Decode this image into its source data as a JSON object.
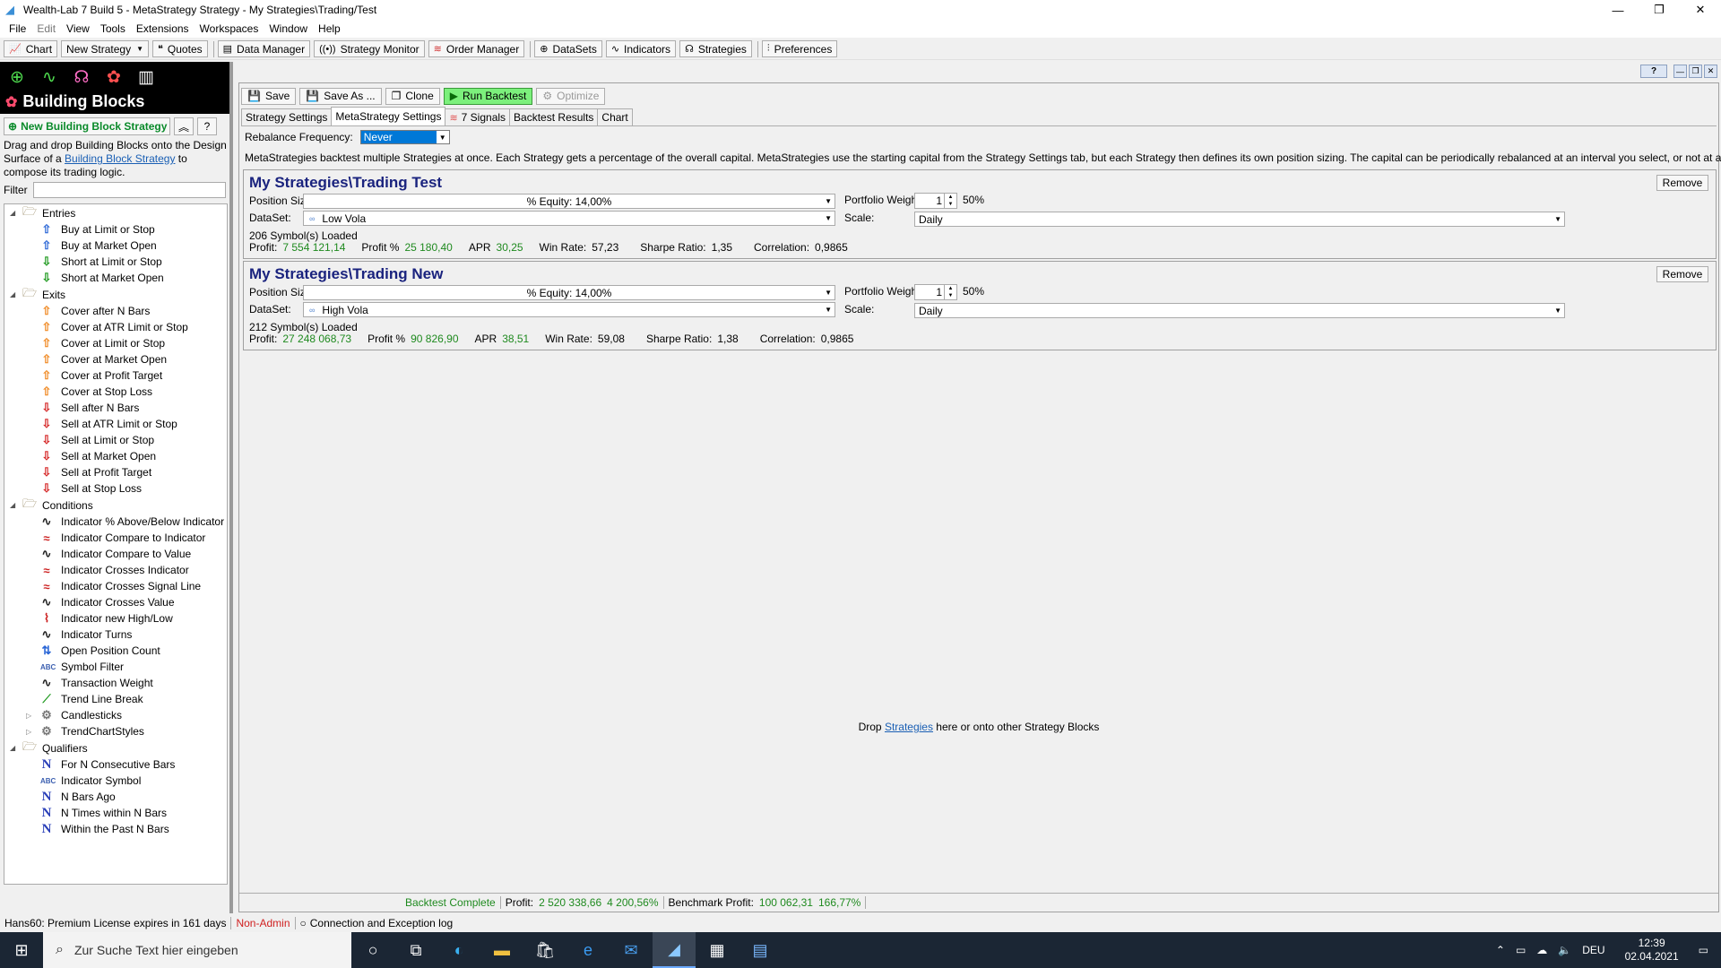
{
  "window": {
    "title": "Wealth-Lab 7 Build 5 - MetaStrategy Strategy - My Strategies\\Trading/Test",
    "minimize": "—",
    "restore": "❐",
    "close": "✕"
  },
  "menu": [
    "File",
    "Edit",
    "View",
    "Tools",
    "Extensions",
    "Workspaces",
    "Window",
    "Help"
  ],
  "toolbar": {
    "chart": "Chart",
    "new_strategy": "New Strategy",
    "quotes": "Quotes",
    "data_manager": "Data Manager",
    "strategy_monitor": "Strategy Monitor",
    "order_manager": "Order Manager",
    "datasets": "DataSets",
    "indicators": "Indicators",
    "strategies": "Strategies",
    "preferences": "Preferences"
  },
  "left_panel": {
    "title": "Building Blocks",
    "new_button": "New Building Block Strategy",
    "desc_1": "Drag and drop Building Blocks onto the Design Surface of a ",
    "desc_link": "Building Block Strategy",
    "desc_2": " to compose its trading logic.",
    "filter_label": "Filter",
    "filter_value": "",
    "groups": {
      "entries": {
        "label": "Entries",
        "items": [
          "Buy at Limit or Stop",
          "Buy at Market Open",
          "Short at Limit or Stop",
          "Short at Market Open"
        ]
      },
      "exits": {
        "label": "Exits",
        "items": [
          "Cover after N Bars",
          "Cover at ATR Limit or Stop",
          "Cover at Limit or Stop",
          "Cover at Market Open",
          "Cover at Profit Target",
          "Cover at Stop Loss",
          "Sell after N Bars",
          "Sell at ATR Limit or Stop",
          "Sell at Limit or Stop",
          "Sell at Market Open",
          "Sell at Profit Target",
          "Sell at Stop Loss"
        ]
      },
      "conditions": {
        "label": "Conditions",
        "items": [
          "Indicator % Above/Below Indicator",
          "Indicator Compare to Indicator",
          "Indicator Compare to Value",
          "Indicator Crosses Indicator",
          "Indicator Crosses Signal Line",
          "Indicator Crosses Value",
          "Indicator new High/Low",
          "Indicator Turns",
          "Open Position Count",
          "Symbol Filter",
          "Transaction Weight",
          "Trend Line Break",
          "Candlesticks",
          "TrendChartStyles"
        ]
      },
      "qualifiers": {
        "label": "Qualifiers",
        "items": [
          "For N Consecutive Bars",
          "Indicator Symbol",
          "N Bars Ago",
          "N Times within N Bars",
          "Within the Past N Bars"
        ]
      }
    }
  },
  "strategy_toolbar": {
    "save": "Save",
    "save_as": "Save As ...",
    "clone": "Clone",
    "run_backtest": "Run Backtest",
    "optimize": "Optimize",
    "help": "?"
  },
  "tabs": {
    "strategy_settings": "Strategy Settings",
    "metastrategy_settings": "MetaStrategy Settings",
    "signals": "7 Signals",
    "backtest_results": "Backtest Results",
    "chart": "Chart"
  },
  "meta": {
    "rebalance_label": "Rebalance Frequency:",
    "rebalance_value": "Never",
    "description": "MetaStrategies backtest multiple Strategies at once. Each Strategy gets a percentage of the overall capital. MetaStrategies use the starting capital from the Strategy Settings tab, but each Strategy then defines its own position sizing. The capital can be periodically rebalanced at an interval you select, or not at all.",
    "drop_1": "Drop ",
    "drop_link": "Strategies",
    "drop_2": " here or onto other Strategy Blocks"
  },
  "strategies": [
    {
      "title": "My Strategies\\Trading Test",
      "remove": "Remove",
      "position_size_label": "Position Size:",
      "position_size": "% Equity: 14,00%",
      "portfolio_weight_label": "Portfolio Weight:",
      "portfolio_weight": "1",
      "portfolio_pct": "50%",
      "dataset_label": "DataSet:",
      "dataset": "Low Vola",
      "scale_label": "Scale:",
      "scale": "Daily",
      "loaded": "206 Symbol(s) Loaded",
      "profit_label": "Profit:",
      "profit": "7 554 121,14",
      "profit_pct_label": "Profit %",
      "profit_pct": "25 180,40",
      "apr_label": "APR",
      "apr": "30,25",
      "winrate_label": "Win Rate:",
      "winrate": "57,23",
      "sharpe_label": "Sharpe Ratio:",
      "sharpe": "1,35",
      "corr_label": "Correlation:",
      "corr": "0,9865"
    },
    {
      "title": "My Strategies\\Trading New",
      "remove": "Remove",
      "position_size_label": "Position Size:",
      "position_size": "% Equity: 14,00%",
      "portfolio_weight_label": "Portfolio Weight:",
      "portfolio_weight": "1",
      "portfolio_pct": "50%",
      "dataset_label": "DataSet:",
      "dataset": "High Vola",
      "scale_label": "Scale:",
      "scale": "Daily",
      "loaded": "212 Symbol(s) Loaded",
      "profit_label": "Profit:",
      "profit": "27 248 068,73",
      "profit_pct_label": "Profit %",
      "profit_pct": "90 826,90",
      "apr_label": "APR",
      "apr": "38,51",
      "winrate_label": "Win Rate:",
      "winrate": "59,08",
      "sharpe_label": "Sharpe Ratio:",
      "sharpe": "1,38",
      "corr_label": "Correlation:",
      "corr": "0,9865"
    }
  ],
  "backtest_status": {
    "complete": "Backtest Complete",
    "profit_label": "Profit:",
    "profit": "2 520 338,66",
    "profit_pct": "4 200,56%",
    "benchmark_label": "Benchmark Profit:",
    "benchmark": "100 062,31",
    "benchmark_pct": "166,77%"
  },
  "statusbar": {
    "license": "Hans60: Premium License expires in 161 days",
    "non_admin": "Non-Admin",
    "log": "Connection and Exception log"
  },
  "taskbar": {
    "search_placeholder": "Zur Suche Text hier eingeben",
    "lang": "DEU",
    "time": "12:39",
    "date": "02.04.2021"
  },
  "colors": {
    "accent_green": "#1f8a1f",
    "run_backtest": "#7cf07c",
    "title_blue": "#1a237e",
    "non_admin_red": "#d02020"
  }
}
